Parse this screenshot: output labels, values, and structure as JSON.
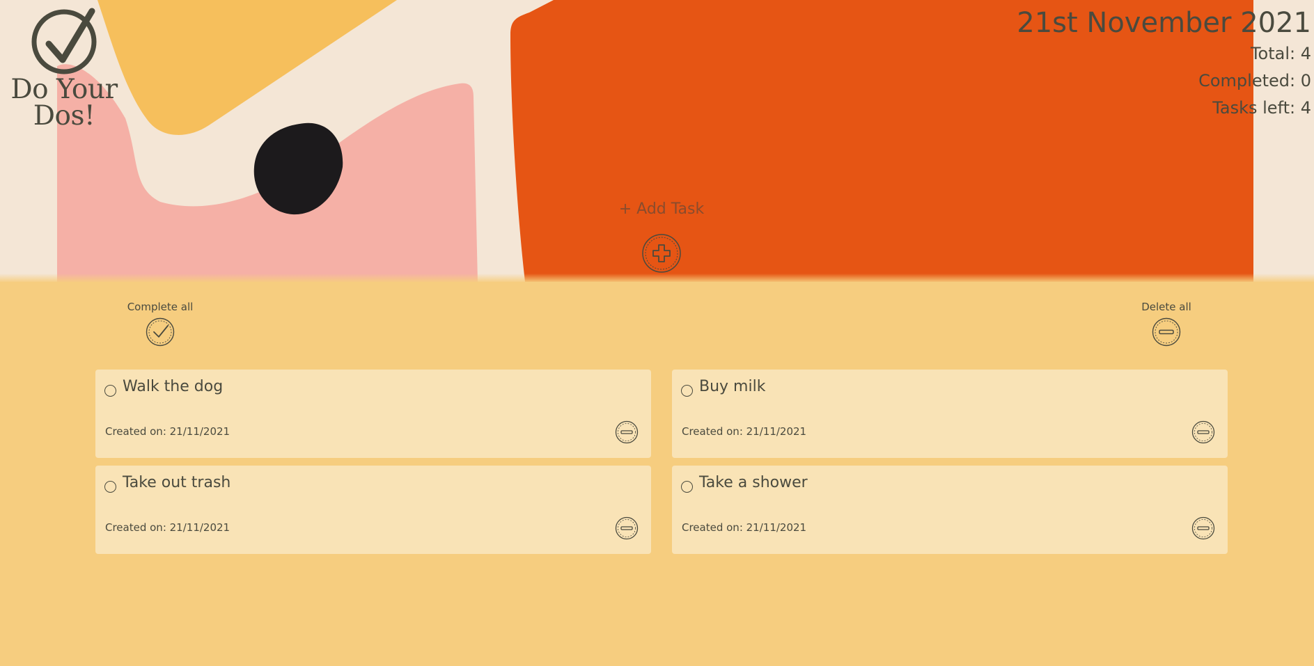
{
  "app": {
    "name": "Do Your Dos!"
  },
  "header": {
    "date": "21st November 2021",
    "total": "Total: 4",
    "completed": "Completed: 0",
    "tasks_left": "Tasks left: 4"
  },
  "add_task": {
    "label": "+ Add Task",
    "icon": "plus-circle-icon"
  },
  "bulk_actions": {
    "complete_all": "Complete all",
    "complete_all_icon": "check-circle-icon",
    "delete_all": "Delete all",
    "delete_all_icon": "minus-circle-icon"
  },
  "tasks": [
    {
      "title": "Walk the dog",
      "created": "Created on: 21/11/2021",
      "completed": false
    },
    {
      "title": "Buy milk",
      "created": "Created on: 21/11/2021",
      "completed": false
    },
    {
      "title": "Take out trash",
      "created": "Created on: 21/11/2021",
      "completed": false
    },
    {
      "title": "Take a shower",
      "created": "Created on: 21/11/2021",
      "completed": false
    }
  ],
  "colors": {
    "page_bg": "#f6cd7f",
    "hero_bg": "#f4e6d6",
    "orange": "#e65514",
    "pink": "#f5b0a6",
    "yellow": "#f6bf5c",
    "card_bg": "#f9e3b6",
    "text": "#4a4a3e"
  }
}
